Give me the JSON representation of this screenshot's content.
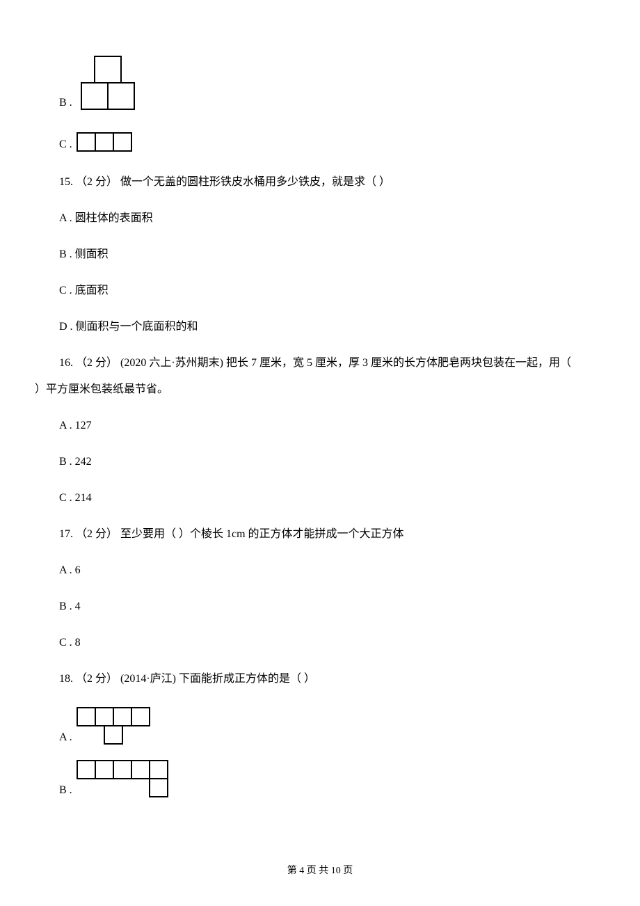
{
  "q14": {
    "optB": {
      "label": "B ."
    },
    "optC": {
      "label": "C ."
    }
  },
  "q15": {
    "stem": "15. （2 分） 做一个无盖的圆柱形铁皮水桶用多少铁皮，就是求（    ）",
    "A": "A . 圆柱体的表面积",
    "B": "B . 侧面积",
    "C": "C . 底面积",
    "D": "D . 侧面积与一个底面积的和"
  },
  "q16": {
    "stem": "16. （2 分） (2020 六上·苏州期末) 把长 7 厘米，宽 5 厘米，厚 3 厘米的长方体肥皂两块包装在一起，用（",
    "stem_cont": "）平方厘米包装纸最节省。",
    "A": "A . 127",
    "B": "B . 242",
    "C": "C . 214"
  },
  "q17": {
    "stem": "17. （2 分） 至少要用（    ）个棱长 1cm 的正方体才能拼成一个大正方体",
    "A": "A . 6",
    "B": "B . 4",
    "C": "C . 8"
  },
  "q18": {
    "stem": "18. （2 分） (2014·庐江) 下面能折成正方体的是（    ）",
    "optA": {
      "label": "A ."
    },
    "optB": {
      "label": "B ."
    }
  },
  "footer": "第 4 页 共 10 页"
}
